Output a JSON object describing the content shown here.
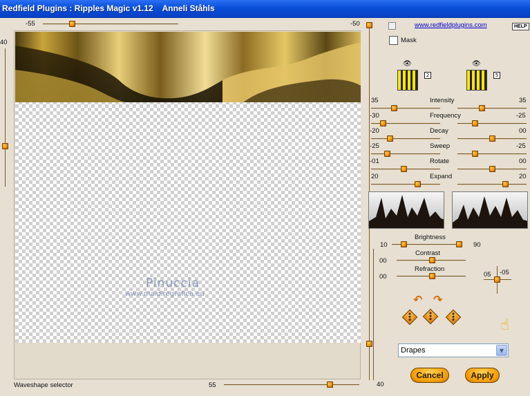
{
  "window": {
    "title": "Redfield Plugins : Ripples Magic v1.12    Anneli Ståhls"
  },
  "top_slider": {
    "left_value": "-55",
    "right_value": "-50"
  },
  "left_slider": {
    "value": "40"
  },
  "bottom": {
    "label": "Waveshape selector",
    "slider_value": "55",
    "right_vslider_value": "40"
  },
  "watermark": {
    "line1": "Pinuccia",
    "line2": "www.maidiregrafica.eu"
  },
  "link": "www.redfieldplugins.com",
  "help_label": "HELP",
  "mask_label": "Mask",
  "swatch_left_tag": "2",
  "swatch_right_tag": "5",
  "params": [
    {
      "name": "Intensity",
      "left": "35",
      "right": "35"
    },
    {
      "name": "Frequency",
      "left": "-30",
      "right": "-25"
    },
    {
      "name": "Decay",
      "left": "-20",
      "right": "00"
    },
    {
      "name": "Sweep",
      "left": "-25",
      "right": "-25"
    },
    {
      "name": "Rotate",
      "left": "-01",
      "right": "00"
    },
    {
      "name": "Expand",
      "left": "20",
      "right": "20"
    }
  ],
  "light": {
    "brightness": {
      "label": "Brightness",
      "left": "10",
      "right": "90"
    },
    "contrast": {
      "label": "Contrast",
      "value": "00"
    },
    "refraction": {
      "label": "Refraction",
      "value": "00"
    },
    "xy": {
      "left": "05",
      "right": "-05"
    }
  },
  "dropdown": {
    "selected": "Drapes"
  },
  "buttons": {
    "cancel": "Cancel",
    "apply": "Apply"
  },
  "colors": {
    "accent": "#f29a00",
    "titlebar": "#0a4fd8",
    "panel": "#e6dfd2"
  }
}
